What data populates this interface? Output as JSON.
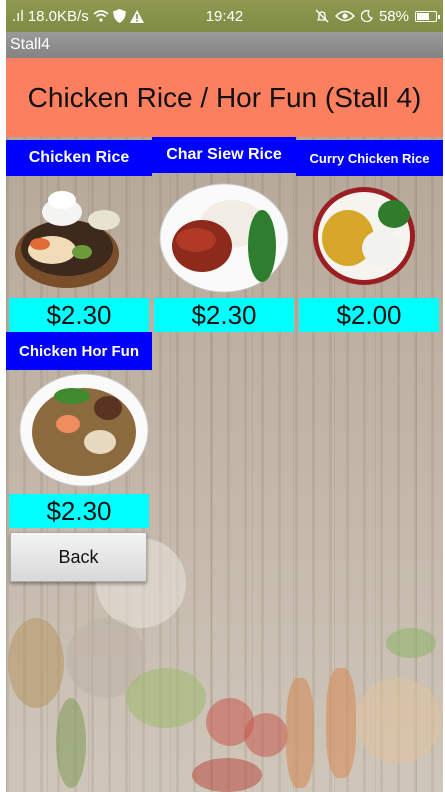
{
  "status_bar": {
    "network": ".ıl 18.0KB/s",
    "time": "19:42",
    "battery": "58%"
  },
  "app_bar": {
    "title": "Stall4"
  },
  "header": {
    "title": "Chicken Rice / Hor Fun (Stall 4)"
  },
  "dishes": [
    {
      "name": "Chicken Rice",
      "price": "$2.30"
    },
    {
      "name": "Char Siew Rice",
      "price": "$2.30"
    },
    {
      "name": "Curry Chicken Rice",
      "price": "$2.00"
    },
    {
      "name": "Chicken Hor Fun",
      "price": "$2.30"
    }
  ],
  "back_button": {
    "label": "Back"
  },
  "colors": {
    "header": "#fc7f5f",
    "label": "#0000ff",
    "price": "#00ffff"
  },
  "icons": [
    "wifi-icon",
    "shield-icon",
    "warning-icon",
    "alarm-icon",
    "eye-icon",
    "battery-icon"
  ]
}
